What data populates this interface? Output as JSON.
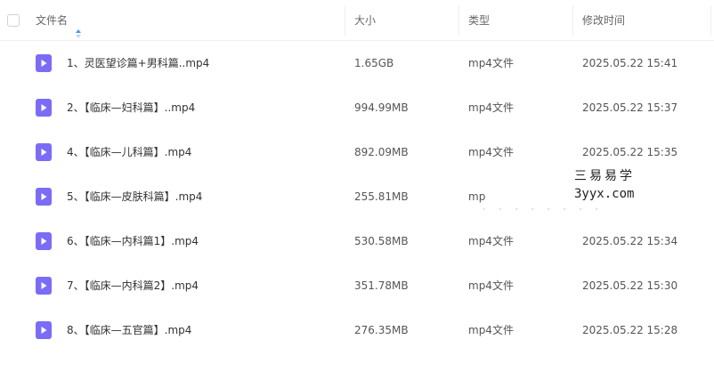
{
  "header": {
    "name_label": "文件名",
    "size_label": "大小",
    "type_label": "类型",
    "time_label": "修改时间"
  },
  "colors": {
    "accent": "#3b9cff",
    "file_icon": "#7b6cf6",
    "divider": "#eceef2"
  },
  "files": [
    {
      "name": "1、灵医望诊篇+男科篇..mp4",
      "size": "1.65GB",
      "type": "mp4文件",
      "time": "2025.05.22 15:41",
      "icon": "video-file-icon"
    },
    {
      "name": "2、【临床—妇科篇】..mp4",
      "size": "994.99MB",
      "type": "mp4文件",
      "time": "2025.05.22 15:37",
      "icon": "video-file-icon"
    },
    {
      "name": "4、【临床—儿科篇】.mp4",
      "size": "892.09MB",
      "type": "mp4文件",
      "time": "2025.05.22 15:35",
      "icon": "video-file-icon"
    },
    {
      "name": "5、【临床—皮肤科篇】.mp4",
      "size": "255.81MB",
      "type": "mp",
      "time": "",
      "icon": "video-file-icon"
    },
    {
      "name": "6、【临床—内科篇1】.mp4",
      "size": "530.58MB",
      "type": "mp4文件",
      "time": "2025.05.22 15:34",
      "icon": "video-file-icon"
    },
    {
      "name": "7、【临床—内科篇2】.mp4",
      "size": "351.78MB",
      "type": "mp4文件",
      "time": "2025.05.22 15:30",
      "icon": "video-file-icon"
    },
    {
      "name": "8、【临床—五官篇】.mp4",
      "size": "276.35MB",
      "type": "mp4文件",
      "time": "2025.05.22 15:28",
      "icon": "video-file-icon"
    }
  ],
  "watermark": {
    "line1": "三易易学",
    "line2": "3yyx.com"
  }
}
